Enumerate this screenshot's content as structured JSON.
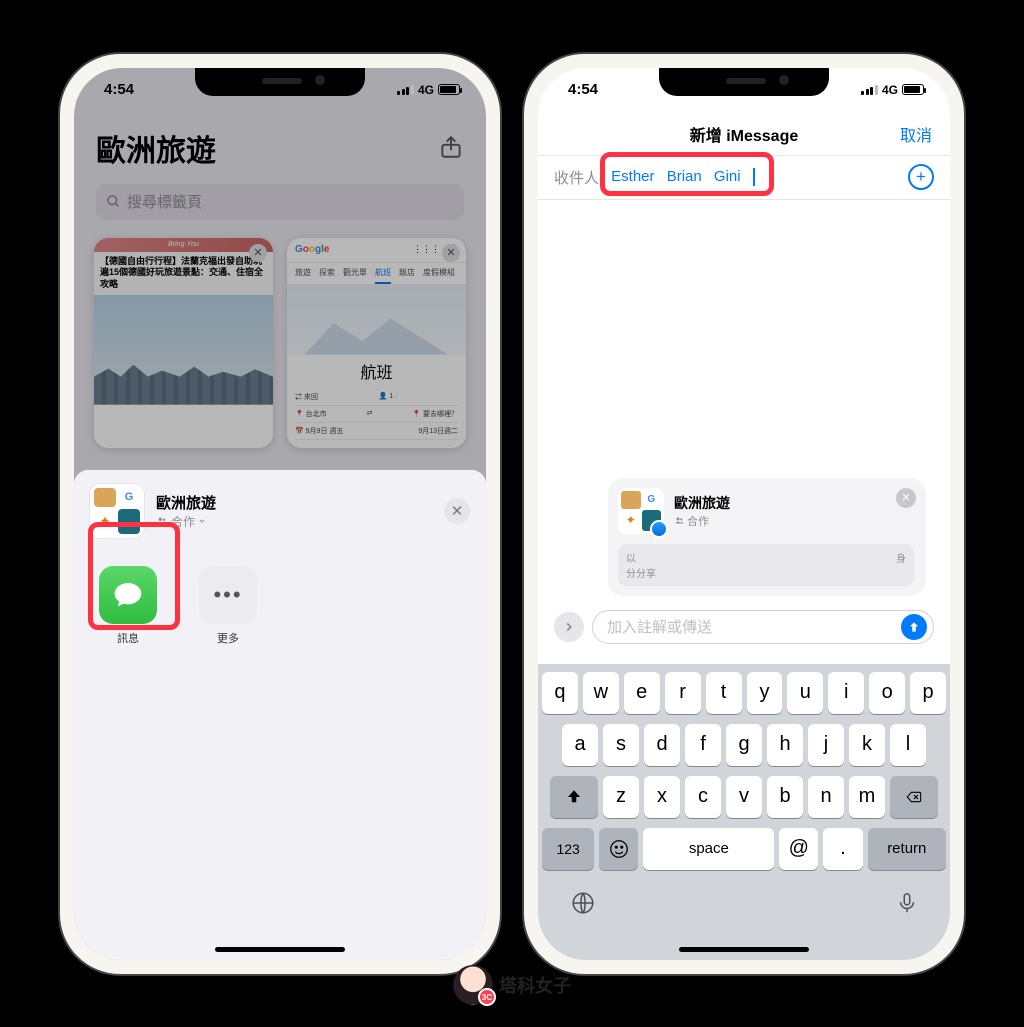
{
  "status": {
    "time": "4:54",
    "network": "4G"
  },
  "left": {
    "group_title": "歐洲旅遊",
    "search_placeholder": "搜尋標籤頁",
    "thumb1": {
      "banner": "Bring·You",
      "title": "【德國自由行行程】法蘭克福出發自助玩遍15個德國好玩旅遊景點：交通、住宿全攻略"
    },
    "thumb2": {
      "tabs": [
        "旅遊",
        "探索",
        "觀光單",
        "航班",
        "飯店",
        "度假模組"
      ],
      "big_label": "航班",
      "rows": {
        "r1a": "⇄ 來回",
        "r1b": "👤 1 ·",
        "r1c": "",
        "r2a": "📍 台北市",
        "r2b": "⇄",
        "r2c": "📍 要去哪裡？",
        "r3a": "📅 9月9日 週五",
        "r3b": "9月13日週二"
      }
    },
    "share": {
      "title": "歐洲旅遊",
      "sub": "合作",
      "apps": {
        "messages": "訊息",
        "more": "更多"
      }
    }
  },
  "right": {
    "nav_title": "新增 iMessage",
    "cancel": "取消",
    "to_label": "收件人:",
    "recipients": [
      "Esther",
      "Brian",
      "Gini"
    ],
    "preview": {
      "title": "歐洲旅遊",
      "sub": "合作",
      "line1": "以",
      "line2": "分分享",
      "corner": "身"
    },
    "input_placeholder": "加入註解或傳送",
    "keyboard": {
      "row1": [
        "q",
        "w",
        "e",
        "r",
        "t",
        "y",
        "u",
        "i",
        "o",
        "p"
      ],
      "row2": [
        "a",
        "s",
        "d",
        "f",
        "g",
        "h",
        "j",
        "k",
        "l"
      ],
      "row3": [
        "z",
        "x",
        "c",
        "v",
        "b",
        "n",
        "m"
      ],
      "k123": "123",
      "space": "space",
      "at": "@",
      "dot": ".",
      "return": "return"
    }
  },
  "watermark": "塔科女子",
  "watermark_badge": "3C"
}
